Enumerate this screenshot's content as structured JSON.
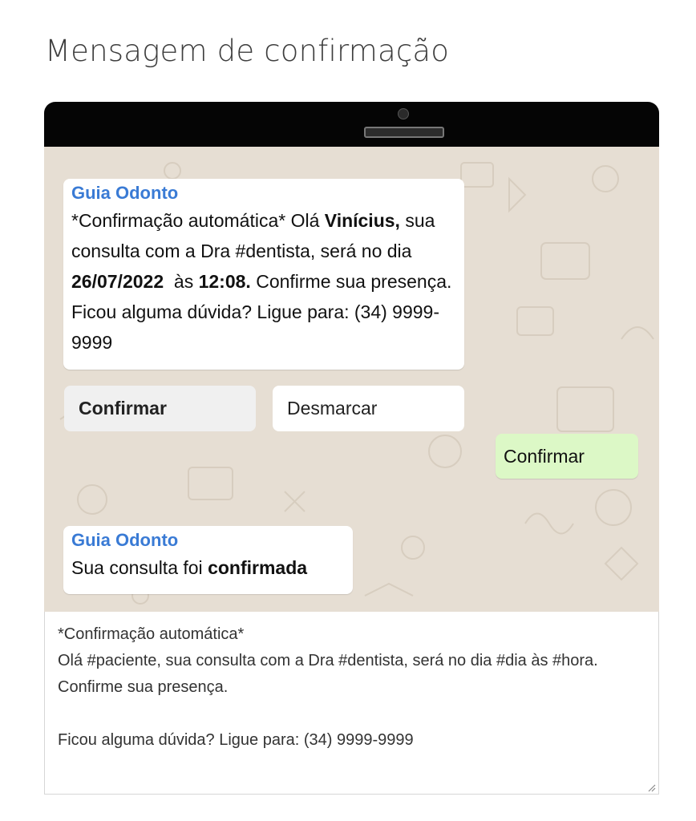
{
  "page": {
    "title": "Mensagem de confirmação"
  },
  "message_1": {
    "sender": "Guia Odonto",
    "intro": "*Confirmação automática* Olá ",
    "patient": "Vinícius,",
    "body": " sua consulta com a Dra #dentista, será no dia ",
    "date": "26/07/2022",
    "at": "  às ",
    "time": "12:08.",
    "closing": "  Confirme sua presença. Ficou alguma dúvida? Ligue para: (34) 9999-9999"
  },
  "quick_replies": {
    "confirm": "Confirmar",
    "cancel": "Desmarcar"
  },
  "sent_reply": {
    "text": "Confirmar"
  },
  "message_2": {
    "sender": "Guia Odonto",
    "text": "Sua consulta foi ",
    "bold": "confirmada"
  },
  "template_editor": {
    "value": "*Confirmação automática*\nOlá #paciente, sua consulta com a Dra #dentista, será no dia #dia às #hora. Confirme sua presença.\n\nFicou alguma dúvida? Ligue para: (34) 9999-9999"
  },
  "colors": {
    "sender": "#3a7bd5",
    "chat_background": "#e6ded3",
    "sent_bubble": "#dcf8c6",
    "phone_frame": "#050505"
  }
}
